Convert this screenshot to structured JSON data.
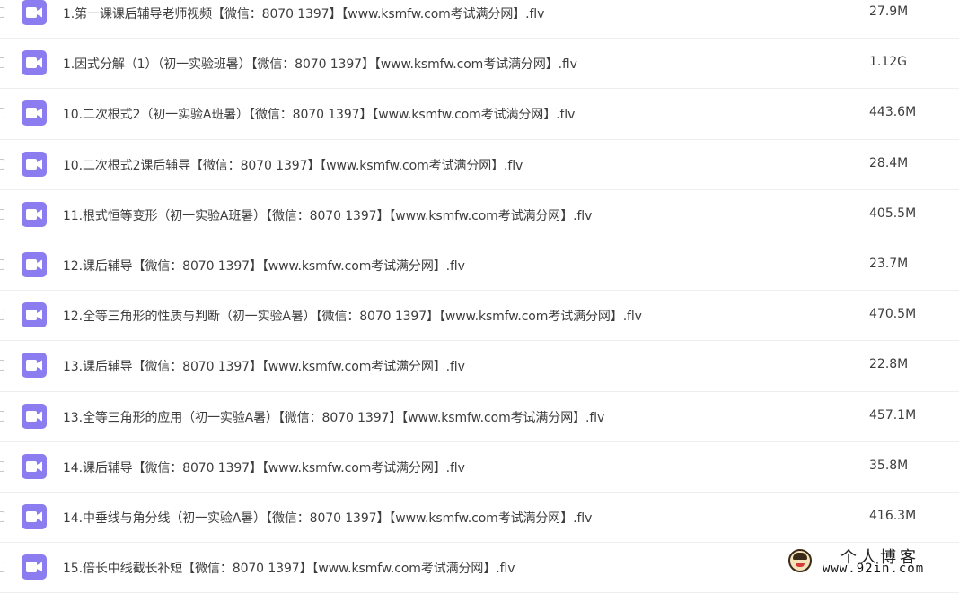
{
  "files": [
    {
      "name": "1.第一课课后辅导老师视频【微信：8070 1397】【www.ksmfw.com考试满分网】.flv",
      "size": "27.9M"
    },
    {
      "name": "1.因式分解（1）（初一实验班暑）【微信：8070 1397】【www.ksmfw.com考试满分网】.flv",
      "size": "1.12G"
    },
    {
      "name": "10.二次根式2（初一实验A班暑）【微信：8070 1397】【www.ksmfw.com考试满分网】.flv",
      "size": "443.6M"
    },
    {
      "name": "10.二次根式2课后辅导【微信：8070 1397】【www.ksmfw.com考试满分网】.flv",
      "size": "28.4M"
    },
    {
      "name": "11.根式恒等变形（初一实验A班暑）【微信：8070 1397】【www.ksmfw.com考试满分网】.flv",
      "size": "405.5M"
    },
    {
      "name": "12.课后辅导【微信：8070 1397】【www.ksmfw.com考试满分网】.flv",
      "size": "23.7M"
    },
    {
      "name": "12.全等三角形的性质与判断（初一实验A暑）【微信：8070 1397】【www.ksmfw.com考试满分网】.flv",
      "size": "470.5M"
    },
    {
      "name": "13.课后辅导【微信：8070 1397】【www.ksmfw.com考试满分网】.flv",
      "size": "22.8M"
    },
    {
      "name": "13.全等三角形的应用（初一实验A暑）【微信：8070 1397】【www.ksmfw.com考试满分网】.flv",
      "size": "457.1M"
    },
    {
      "name": "14.课后辅导【微信：8070 1397】【www.ksmfw.com考试满分网】.flv",
      "size": "35.8M"
    },
    {
      "name": "14.中垂线与角分线（初一实验A暑）【微信：8070 1397】【www.ksmfw.com考试满分网】.flv",
      "size": "416.3M"
    },
    {
      "name": "15.倍长中线截长补短【微信：8070 1397】【www.ksmfw.com考试满分网】.flv",
      "size": ""
    }
  ],
  "icons": {
    "file_type": "video-file-icon",
    "checkbox": "checkbox-icon"
  },
  "colors": {
    "icon_bg": "#8b7cf0",
    "text": "#3d3d3d",
    "divider": "#eeeeee"
  },
  "watermark": {
    "title": "个人博客",
    "url": "www.92in.com"
  }
}
